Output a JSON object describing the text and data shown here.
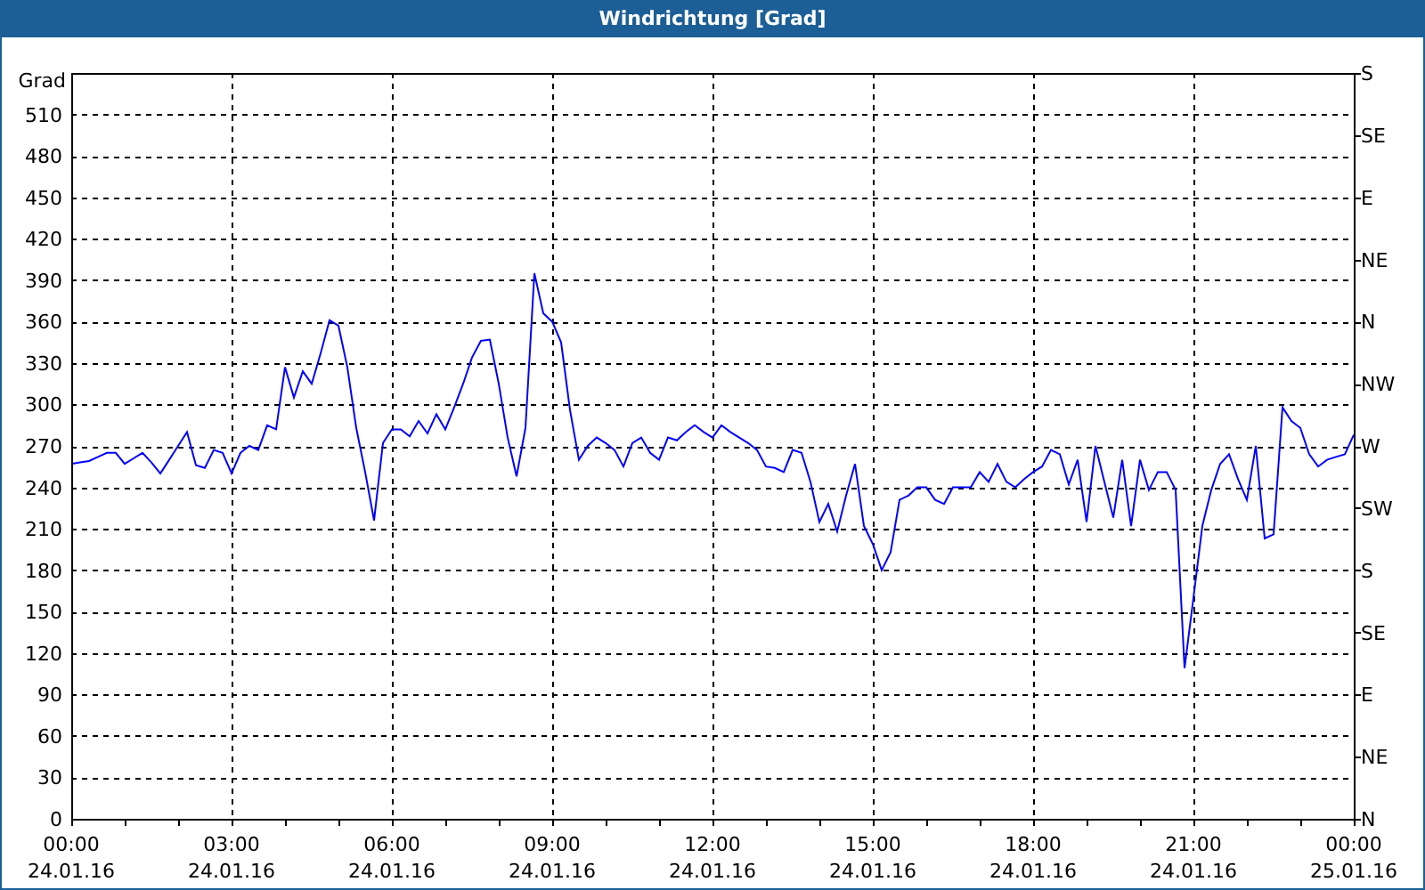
{
  "window": {
    "title": "Windrichtung [Grad]"
  },
  "chart": {
    "chart_data": {
      "type": "line",
      "grid": true,
      "ylabel": "Grad",
      "ylim": [
        0,
        540
      ],
      "yticks": [
        0,
        30,
        60,
        90,
        120,
        150,
        180,
        210,
        240,
        270,
        300,
        330,
        360,
        390,
        420,
        450,
        480,
        510
      ],
      "categories": [
        "00:00\n24.01.16",
        null,
        null,
        null,
        null,
        null,
        null,
        null,
        null,
        null,
        null,
        null,
        null,
        null,
        null,
        null,
        null,
        null,
        "03:00\n24.01.16",
        null,
        null,
        null,
        null,
        null,
        null,
        null,
        null,
        null,
        null,
        null,
        null,
        null,
        null,
        null,
        null,
        null,
        "06:00\n24.01.16",
        null,
        null,
        null,
        null,
        null,
        null,
        null,
        null,
        null,
        null,
        null,
        null,
        null,
        null,
        null,
        null,
        null,
        "09:00\n24.01.16",
        null,
        null,
        null,
        null,
        null,
        null,
        null,
        null,
        null,
        null,
        null,
        null,
        null,
        null,
        null,
        null,
        null,
        "12:00\n24.01.16",
        null,
        null,
        null,
        null,
        null,
        null,
        null,
        null,
        null,
        null,
        null,
        null,
        null,
        null,
        null,
        null,
        null,
        "15:00\n24.01.16",
        null,
        null,
        null,
        null,
        null,
        null,
        null,
        null,
        null,
        null,
        null,
        null,
        null,
        null,
        null,
        null,
        null,
        "18:00\n24.01.16",
        null,
        null,
        null,
        null,
        null,
        null,
        null,
        null,
        null,
        null,
        null,
        null,
        null,
        null,
        null,
        null,
        null,
        "21:00\n24.01.16",
        null,
        null,
        null,
        null,
        null,
        null,
        null,
        null,
        null,
        null,
        null,
        null,
        null,
        null,
        null,
        null,
        null,
        "00:00\n25.01.16"
      ],
      "series": [
        {
          "color": "#0000ff",
          "values": [
            257,
            258,
            259,
            262,
            265,
            265,
            257,
            261,
            265,
            258,
            250,
            260,
            270,
            280,
            256,
            254,
            267,
            265,
            250,
            265,
            270,
            267,
            285,
            282,
            327,
            305,
            324,
            315,
            337,
            361,
            357,
            327,
            283,
            251,
            216,
            272,
            282,
            282,
            277,
            288,
            279,
            293,
            282,
            298,
            315,
            334,
            346,
            347,
            315,
            276,
            248,
            283,
            395,
            366,
            360,
            345,
            296,
            260,
            270,
            276,
            272,
            267,
            255,
            272,
            276,
            265,
            260,
            276,
            274,
            280,
            285,
            280,
            276,
            285,
            280,
            276,
            272,
            267,
            255,
            254,
            251,
            267,
            265,
            244,
            215,
            228,
            208,
            234,
            257,
            212,
            199,
            180,
            193,
            231,
            234,
            240,
            240,
            231,
            228,
            240,
            240,
            240,
            251,
            244,
            257,
            244,
            240,
            246,
            251,
            255,
            267,
            264,
            242,
            260,
            215,
            270,
            244,
            218,
            260,
            212,
            260,
            238,
            251,
            251,
            238,
            109,
            160,
            212,
            238,
            257,
            264,
            246,
            231,
            270,
            203,
            206,
            298,
            288,
            283,
            264,
            255,
            260,
            262,
            264,
            278
          ]
        }
      ]
    },
    "compass_labels": [
      "S",
      "SE",
      "E",
      "NE",
      "N",
      "NW",
      "W",
      "SW",
      "S",
      "SE",
      "E",
      "NE",
      "N"
    ]
  }
}
